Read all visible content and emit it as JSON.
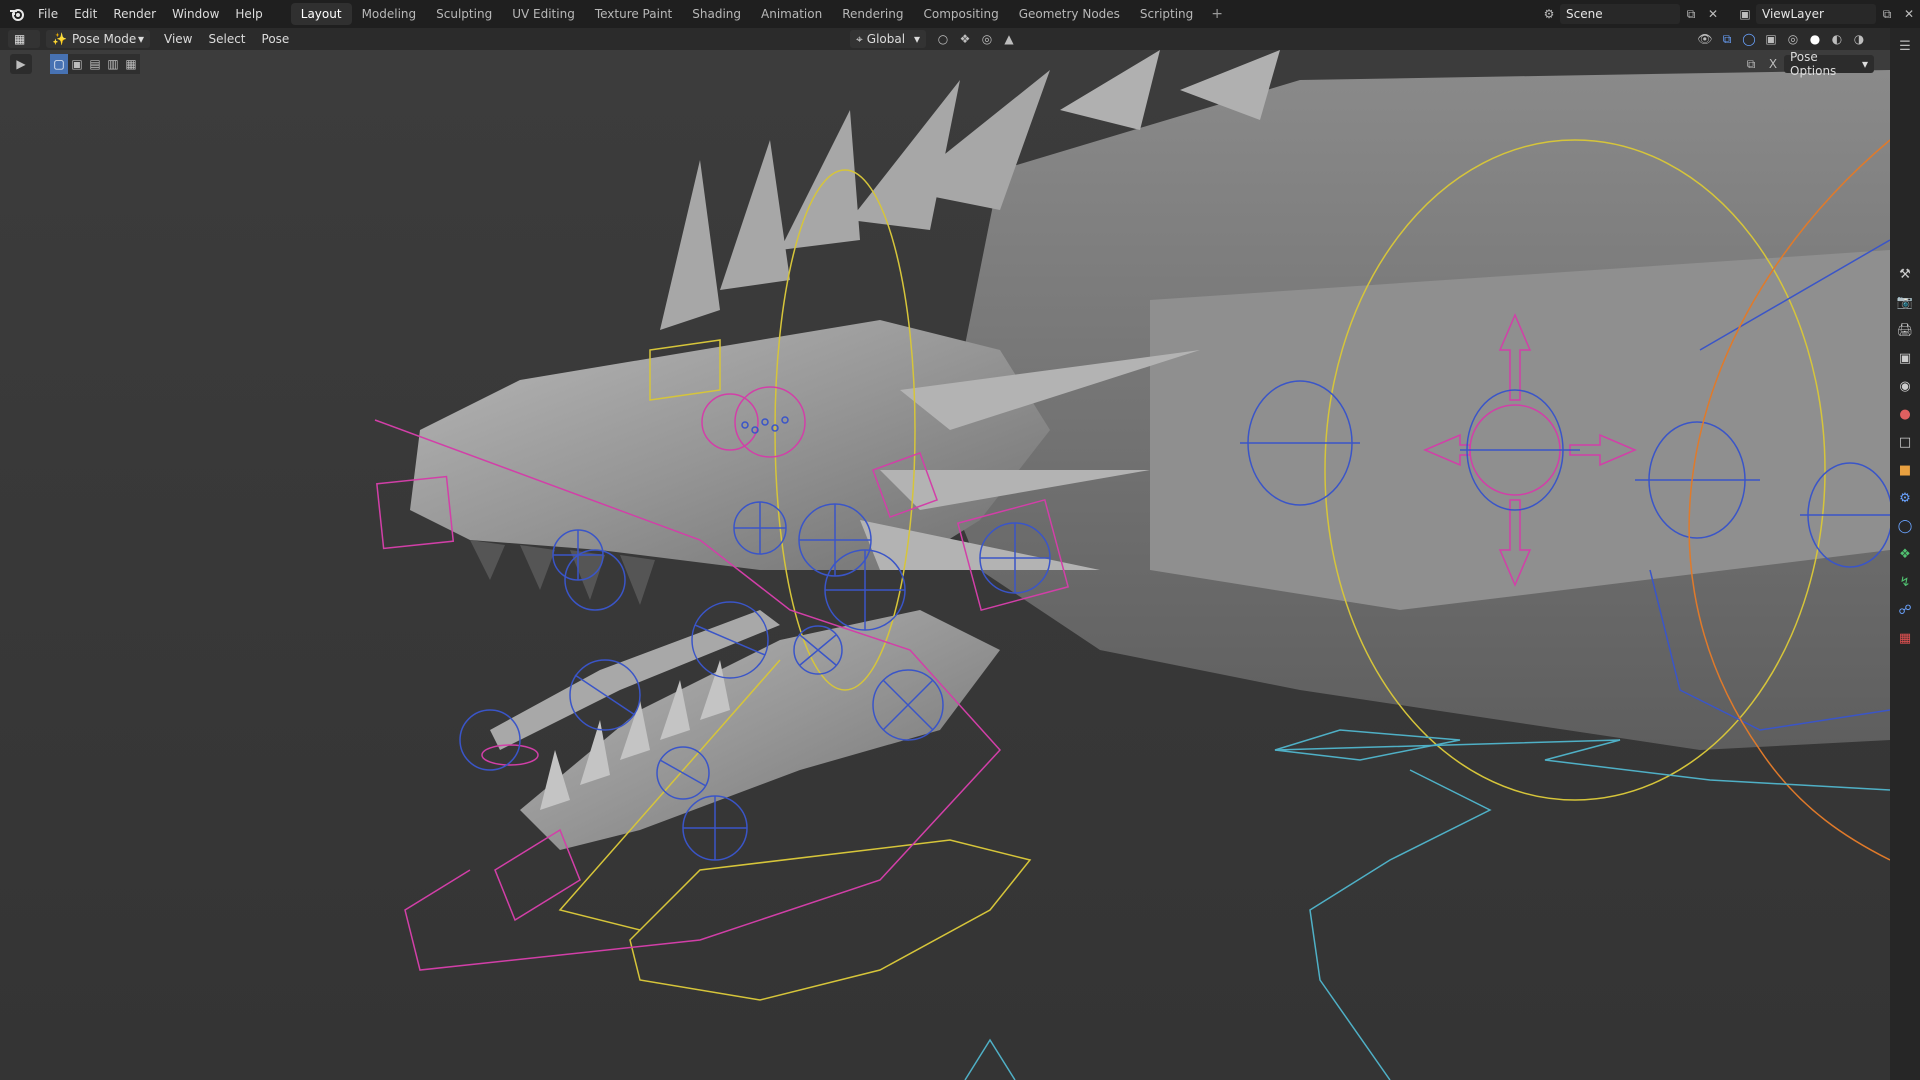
{
  "menu": [
    "File",
    "Edit",
    "Render",
    "Window",
    "Help"
  ],
  "workspaces": [
    "Layout",
    "Modeling",
    "Sculpting",
    "UV Editing",
    "Texture Paint",
    "Shading",
    "Animation",
    "Rendering",
    "Compositing",
    "Geometry Nodes",
    "Scripting"
  ],
  "active_workspace": "Layout",
  "add_workspace": "+",
  "scene": {
    "name": "Scene"
  },
  "viewlayer": {
    "name": "ViewLayer"
  },
  "header": {
    "mode": "Pose Mode",
    "menus": [
      "View",
      "Select",
      "Pose"
    ],
    "transform_orientation": "Global"
  },
  "toolrow": {
    "pose_options": "Pose Options"
  },
  "colors": {
    "bone_blue": "#3a55c8",
    "bone_magenta": "#d23fa8",
    "bone_yellow": "#d6c53a",
    "bone_cyan": "#4fb0c6",
    "bone_orange": "#e07a2a",
    "mesh_gray": "#9a9a9a"
  },
  "properties_icons": [
    "tool-icon",
    "render-icon",
    "output-icon",
    "view-layer-icon",
    "scene-icon",
    "world-icon",
    "collection-icon",
    "object-icon",
    "modifier-icon",
    "physics-icon",
    "constraints-icon",
    "data-icon",
    "bone-icon",
    "bone-constraint-icon",
    "texture-icon"
  ]
}
